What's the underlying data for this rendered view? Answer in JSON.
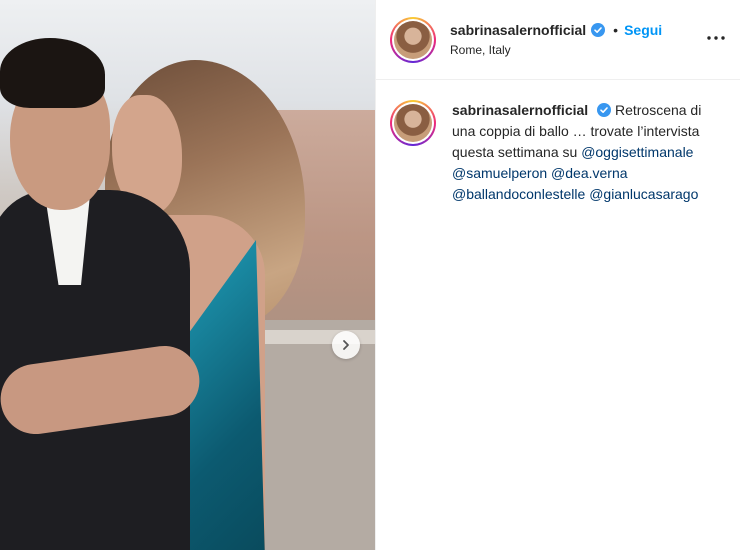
{
  "post": {
    "username": "sabrinasalernofficial",
    "follow_label": "Segui",
    "separator": "•",
    "location": "Rome, Italy",
    "caption": {
      "text_before": "Retroscena di una coppia di ballo … trovate l’intervista questa settimana su ",
      "mentions": [
        "@oggisettimanale",
        "@samuelperon",
        "@dea.verna",
        "@ballandoconlestelle",
        "@gianlucasarago"
      ]
    }
  },
  "icons": {
    "verified": "verified-badge-icon",
    "more": "more-options-icon",
    "next": "chevron-right-icon"
  },
  "colors": {
    "follow": "#0095f6",
    "mention": "#00376b",
    "verified": "#3897f0"
  }
}
